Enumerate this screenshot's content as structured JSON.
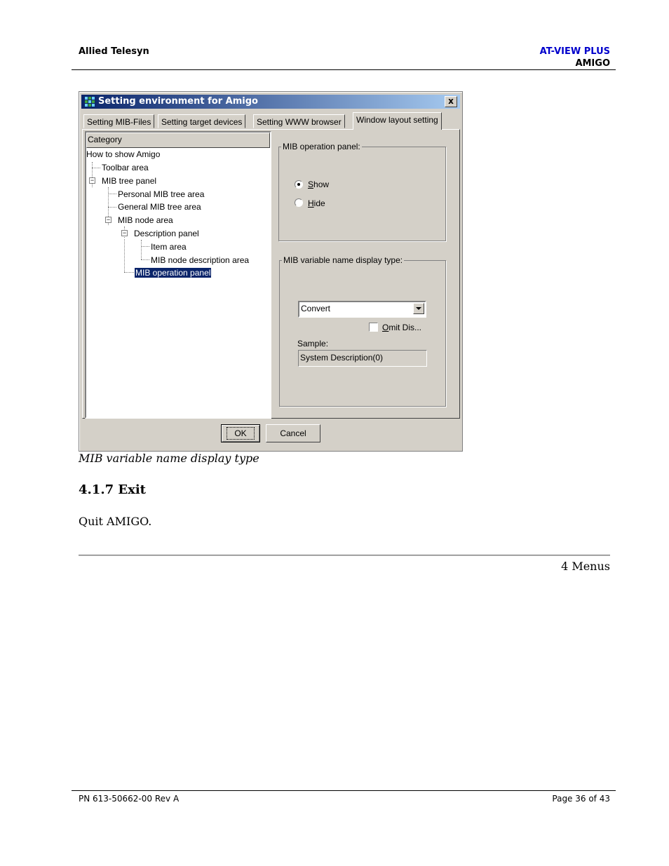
{
  "header": {
    "company": "Allied Telesyn",
    "product": "AT-VIEW PLUS",
    "module": "AMIGO"
  },
  "colors": {
    "product_title": "#0000cc",
    "titlebar": "#0a246a",
    "selection": "#0a246a"
  },
  "dialog": {
    "title": "Setting environment for Amigo",
    "close_glyph": "x",
    "tabs": [
      "Setting MIB-Files",
      "Setting target devices",
      "Setting WWW browser",
      "Window layout setting"
    ],
    "active_tab": "Window layout setting",
    "tree": {
      "header": "Category",
      "nodes": [
        "How to show Amigo",
        "Toolbar area",
        "MIB tree panel",
        "Personal MIB tree area",
        "General MIB tree area",
        "MIB node area",
        "Description panel",
        "Item area",
        "MIB node description area",
        "MIB operation panel"
      ],
      "selected": "MIB operation panel"
    },
    "operation_group": {
      "label": "MIB operation panel:",
      "show": "Show",
      "hide": "Hide",
      "selected": "Show"
    },
    "name_display_group": {
      "label": "MIB variable name display type:",
      "combo_value": "Convert",
      "omit_checkbox": "Omit Dis...",
      "omit_checked": false,
      "sample_label": "Sample:",
      "sample_value": "System Description(0)"
    },
    "ok": "OK",
    "cancel": "Cancel"
  },
  "doc": {
    "caption": "MIB variable name display type",
    "section": "4.1.7 Exit",
    "body": "Quit AMIGO.",
    "chapter": "4 Menus"
  },
  "footer": {
    "part_number": "PN 613-50662-00 Rev A",
    "page": "Page 36 of 43"
  }
}
